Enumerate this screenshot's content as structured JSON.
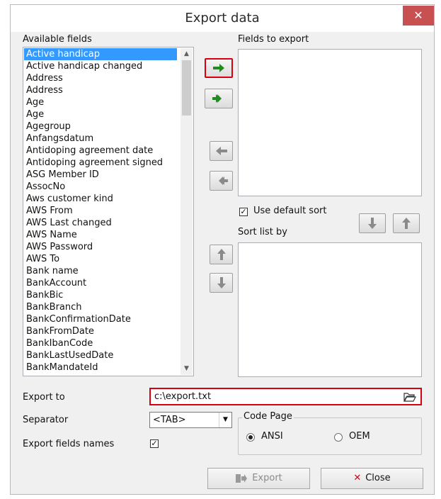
{
  "window": {
    "title": "Export data",
    "close_glyph": "✕"
  },
  "available": {
    "label": "Available fields",
    "items": [
      "Active handicap",
      "Active handicap changed",
      "Address",
      "Address",
      "Age",
      "Age",
      "Agegroup",
      "Anfangsdatum",
      "Antidoping agreement date",
      "Antidoping agreement signed",
      "ASG Member ID",
      "AssocNo",
      "Aws customer kind",
      "AWS From",
      "AWS Last changed",
      "AWS Name",
      "AWS Password",
      "AWS To",
      "Bank name",
      "BankAccount",
      "BankBic",
      "BankBranch",
      "BankConfirmationDate",
      "BankFromDate",
      "BankIbanCode",
      "BankLastUsedDate",
      "BankMandateId"
    ],
    "selected_index": 0
  },
  "fields_to_export": {
    "label": "Fields to export"
  },
  "sort": {
    "use_default_label": "Use default sort",
    "use_default_checked": true,
    "list_label": "Sort list by"
  },
  "export_to": {
    "label": "Export to",
    "value": "c:\\export.txt"
  },
  "separator": {
    "label": "Separator",
    "value": "<TAB>"
  },
  "export_names": {
    "label": "Export fields names",
    "checked": true
  },
  "code_page": {
    "label": "Code Page",
    "options": [
      "ANSI",
      "OEM"
    ],
    "selected": "ANSI"
  },
  "buttons": {
    "export_label": "Export",
    "close_label": "Close"
  },
  "colors": {
    "accent_red": "#d6000f",
    "selection": "#3399ff",
    "arrow_green": "#1e8c1e"
  }
}
